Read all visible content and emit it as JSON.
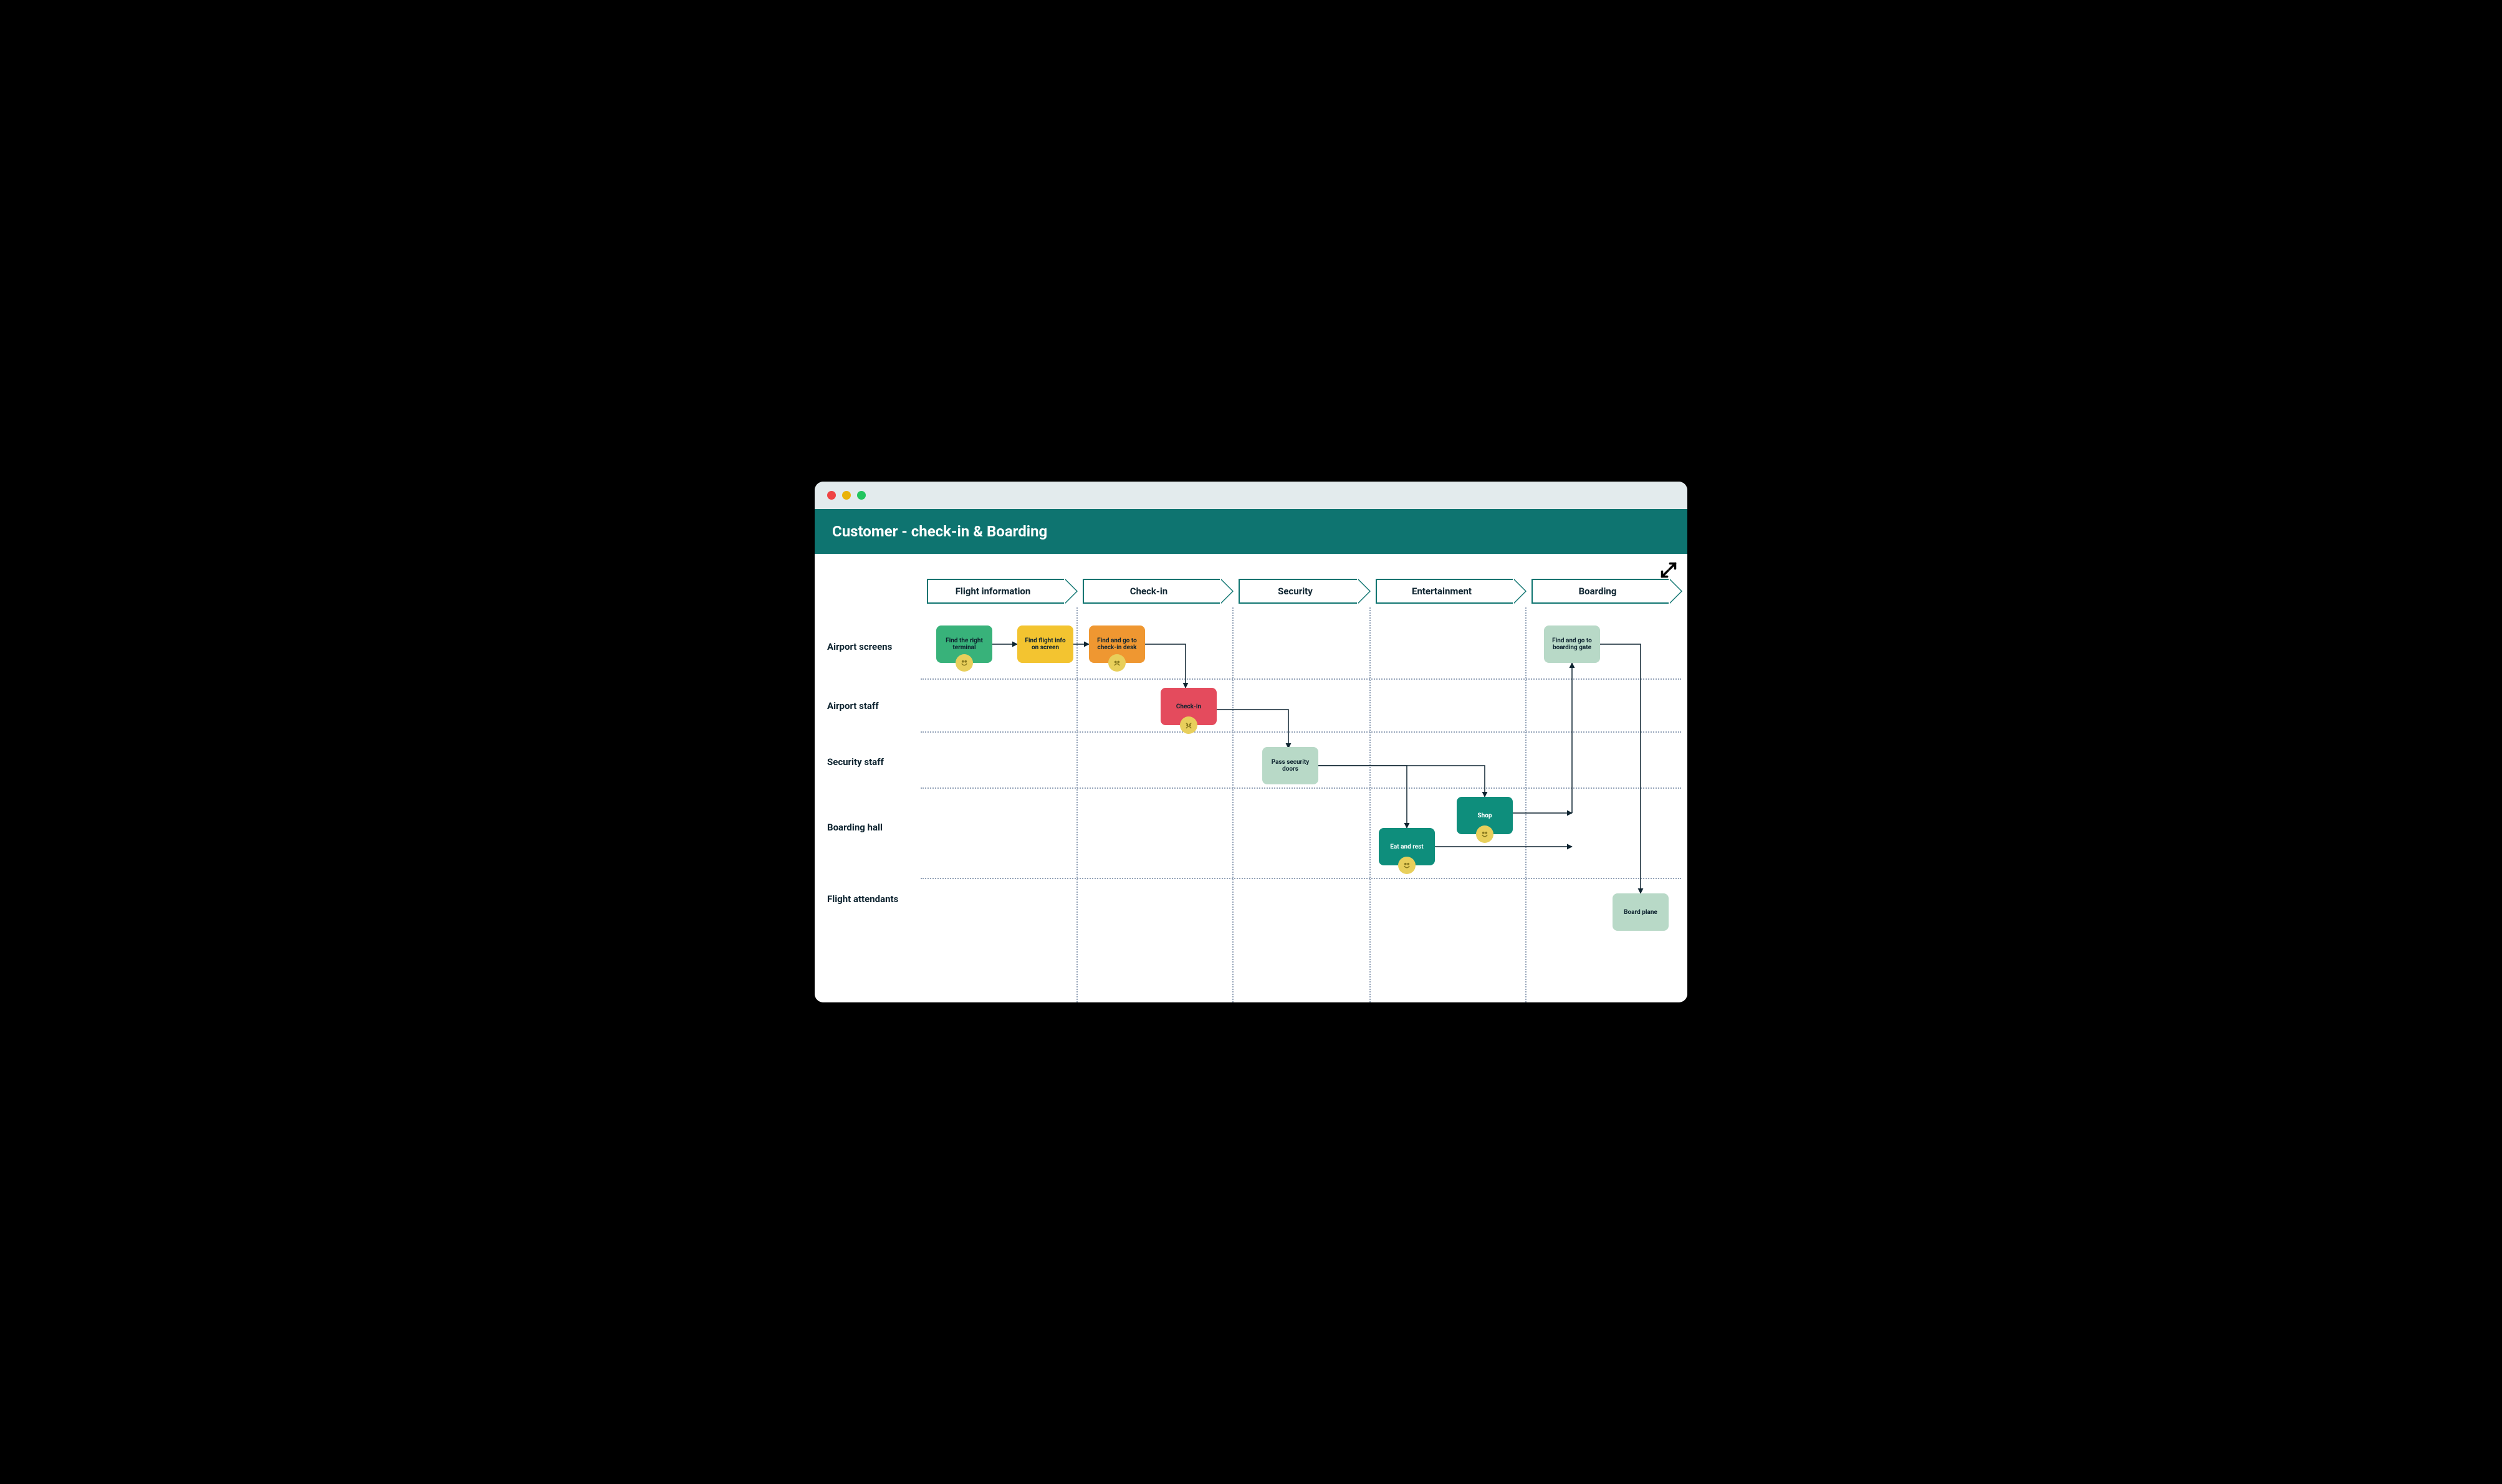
{
  "header": {
    "title": "Customer - check-in & Boarding"
  },
  "phases": [
    {
      "label": "Flight information"
    },
    {
      "label": "Check-in"
    },
    {
      "label": "Security"
    },
    {
      "label": "Entertainment"
    },
    {
      "label": "Boarding"
    }
  ],
  "lanes": [
    {
      "label": "Airport screens"
    },
    {
      "label": "Airport staff"
    },
    {
      "label": "Security staff"
    },
    {
      "label": "Boarding hall"
    },
    {
      "label": "Flight attendants"
    }
  ],
  "steps": {
    "find_terminal": {
      "text": "Find the right terminal",
      "mood": "happy"
    },
    "flight_info": {
      "text": "Find flight info on screen",
      "mood": null
    },
    "go_checkin_desk": {
      "text": "Find and go to check-in desk",
      "mood": "sad"
    },
    "checkin": {
      "text": "Check-in",
      "mood": "angry"
    },
    "security": {
      "text": "Pass security doors",
      "mood": null
    },
    "eat_rest": {
      "text": "Eat and rest",
      "mood": "happy"
    },
    "shop": {
      "text": "Shop",
      "mood": "happy"
    },
    "go_gate": {
      "text": "Find and go to boarding gate",
      "mood": null
    },
    "board": {
      "text": "Board plane",
      "mood": null
    }
  },
  "colors": {
    "teal_header": "#0e7470",
    "step_green": "#38b27a",
    "step_yellow": "#f3c430",
    "step_orange": "#ef9731",
    "step_red": "#e44b5d",
    "step_teal": "#0e8e7c",
    "step_pale": "#b8d9c7",
    "mood_disc": "#e8cf5b"
  }
}
